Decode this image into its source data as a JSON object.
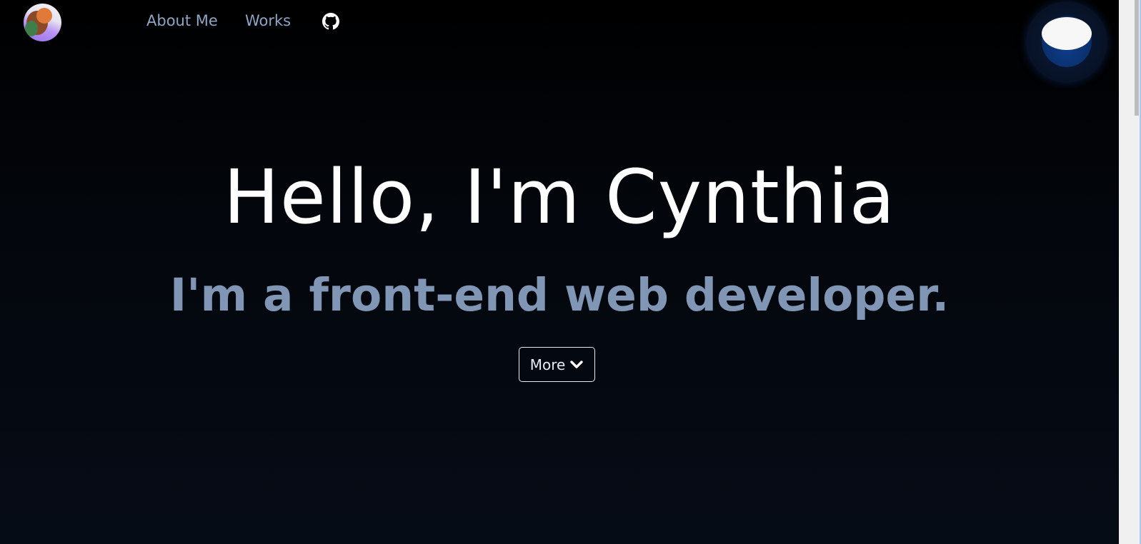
{
  "nav": {
    "about_label": "About Me",
    "works_label": "Works",
    "github_icon": "github-icon"
  },
  "hero": {
    "title": "Hello, I'm Cynthia",
    "subtitle": "I'm a front-end web developer.",
    "more_label": "More",
    "more_icon": "chevron-down-icon"
  },
  "theme_toggle": {
    "icon": "moon-icon"
  },
  "colors": {
    "background": "#020409",
    "nav_link": "#8fa3c2",
    "subtitle": "#8096b4",
    "title": "#ffffff"
  }
}
